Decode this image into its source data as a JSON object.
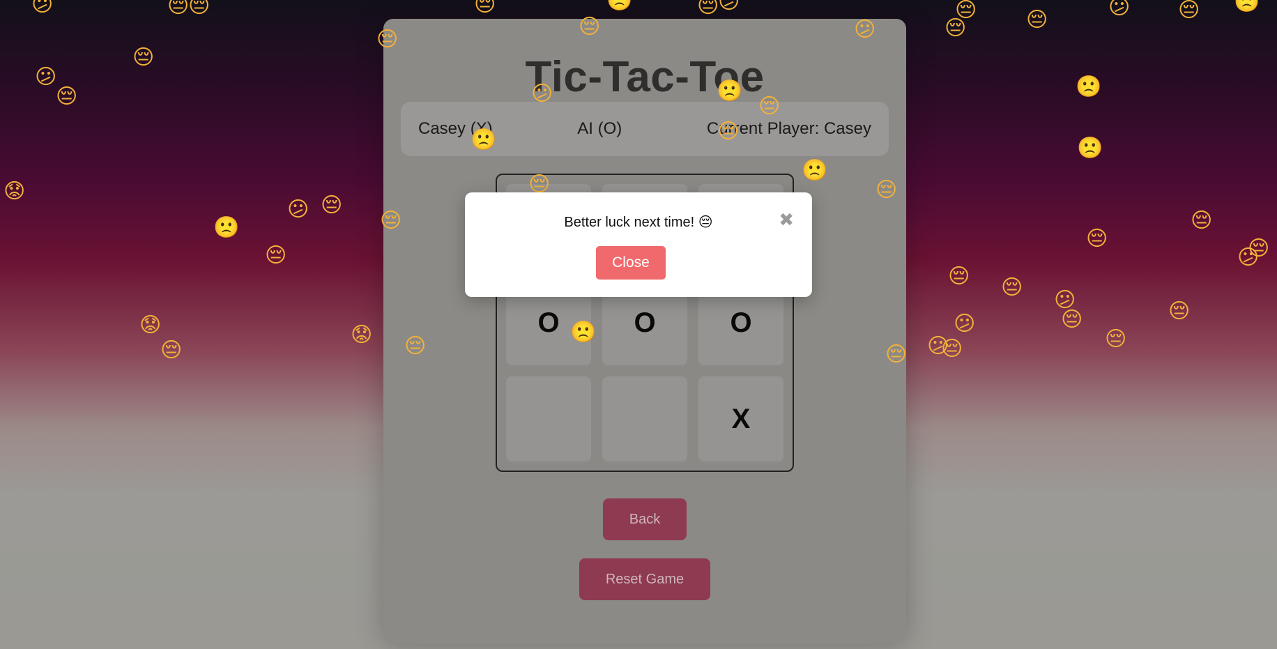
{
  "game": {
    "title": "Tic-Tac-Toe",
    "player_one": "Casey (X)",
    "player_two": "AI (O)",
    "current_player": "Current Player: Casey",
    "board": [
      "",
      "",
      "",
      "O",
      "O",
      "O",
      "",
      "",
      "X"
    ],
    "back_label": "Back",
    "reset_label": "Reset Game"
  },
  "modal": {
    "message": "Better luck next time! 😔",
    "close_x": "✖",
    "close_label": "Close"
  },
  "background": {
    "emoji_types": [
      "😔",
      "😕",
      "🙁",
      "😟"
    ]
  },
  "colors": {
    "button_accent": "#8e3a50",
    "modal_close": "#f06a6d"
  }
}
